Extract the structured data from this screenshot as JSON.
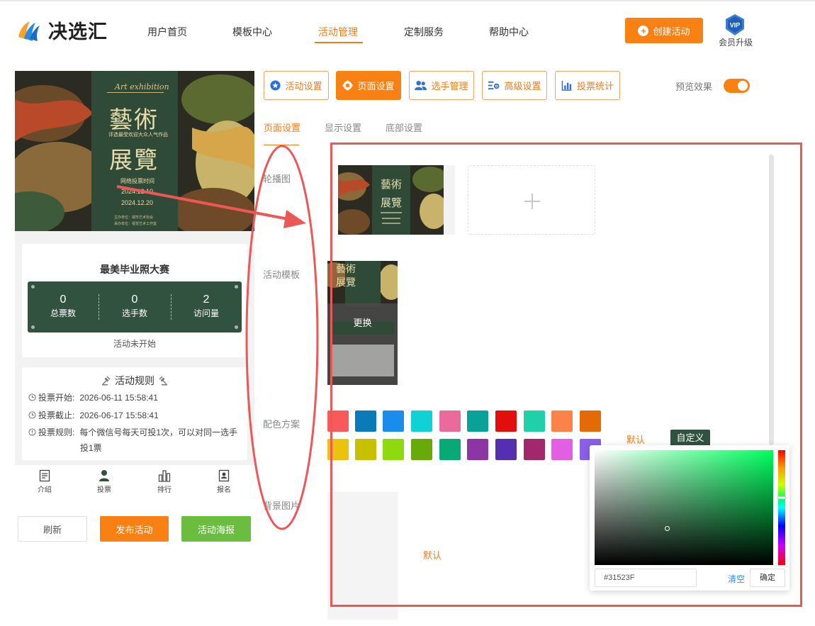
{
  "header": {
    "logo_text": "决选汇",
    "nav": [
      "用户首页",
      "模板中心",
      "活动管理",
      "定制服务",
      "帮助中心"
    ],
    "active_nav": "活动管理",
    "create_button": "创建活动",
    "vip_badge": "VIP",
    "vip_label": "会员升级"
  },
  "poster": {
    "script_title": "Art exhibition",
    "title_line1": "藝術",
    "subtitle": "评选最受欢迎大众人气作品",
    "title_line2": "展覽",
    "vote_time_label": "网络投票时间",
    "date1": "2024.12.10",
    "date2": "2024.12.20",
    "footer1": "主办单位：城市艺术协会",
    "footer2": "承办单位：视觉艺术工作室"
  },
  "activity": {
    "name": "最美毕业照大赛",
    "stats": [
      {
        "value": "0",
        "label": "总票数"
      },
      {
        "value": "0",
        "label": "选手数"
      },
      {
        "value": "2",
        "label": "访问量"
      }
    ],
    "status": "活动未开始"
  },
  "rules": {
    "title": "活动规则",
    "start_label": "投票开始:",
    "start_value": "2026-06-11 15:58:41",
    "end_label": "投票截止:",
    "end_value": "2026-06-17 15:58:41",
    "rule_label": "投票规则:",
    "rule_text_1": "每个微信号每天可投1次，可以对同一选手",
    "rule_text_2": "投1票"
  },
  "mobile_tabs": [
    "介绍",
    "投票",
    "排行",
    "报名"
  ],
  "actions": {
    "refresh": "刷新",
    "publish": "发布活动",
    "poster": "活动海报"
  },
  "toolbar": {
    "tabs": [
      "活动设置",
      "页面设置",
      "选手管理",
      "高级设置",
      "投票统计"
    ],
    "active_tab": "页面设置",
    "preview_label": "预览效果",
    "preview_on": true
  },
  "subtabs": {
    "items": [
      "页面设置",
      "显示设置",
      "底部设置"
    ],
    "active": "页面设置"
  },
  "rows": {
    "carousel": "轮播图",
    "template": "活动模板",
    "color_scheme": "配色方案",
    "background": "背景图片"
  },
  "template": {
    "replace_label": "更换"
  },
  "colors": {
    "palette_row1": [
      "#f85a5b",
      "#0a7ab8",
      "#1a8ceb",
      "#10d2d4",
      "#e86b9b",
      "#0aa198",
      "#e20e0e",
      "#1fd1a8",
      "#fd8248",
      "#e46a05"
    ],
    "palette_row2": [
      "#ebc20e",
      "#c8c103",
      "#8fd90f",
      "#67aa0a",
      "#08a877",
      "#8e35a6",
      "#5430b0",
      "#a2286c",
      "#e25ee3",
      "#8b5fe9"
    ],
    "default_label": "默认",
    "custom_label": "自定义",
    "accent": "#f47b17",
    "brand_green": "#31523f"
  },
  "background": {
    "default_label": "默认"
  },
  "color_picker": {
    "hex_value": "#31523F",
    "clear_label": "清空",
    "confirm_label": "确定"
  }
}
